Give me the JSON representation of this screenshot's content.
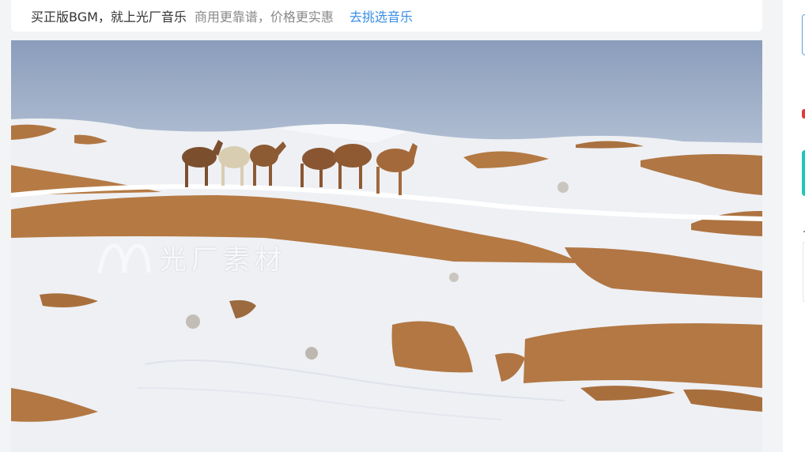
{
  "banner": {
    "promo_text": "买正版BGM，就上光厂音乐",
    "sub_text": "商用更靠谱，价格更实惠",
    "link_text": "去挑选音乐"
  },
  "photo": {
    "description_icon": "landscape-photo",
    "watermark_text": "光厂素材"
  },
  "colors": {
    "link": "#3a8ee6",
    "sky": "#8ea2c0",
    "sand": "#b57a45",
    "snow": "#f4f5f8"
  }
}
